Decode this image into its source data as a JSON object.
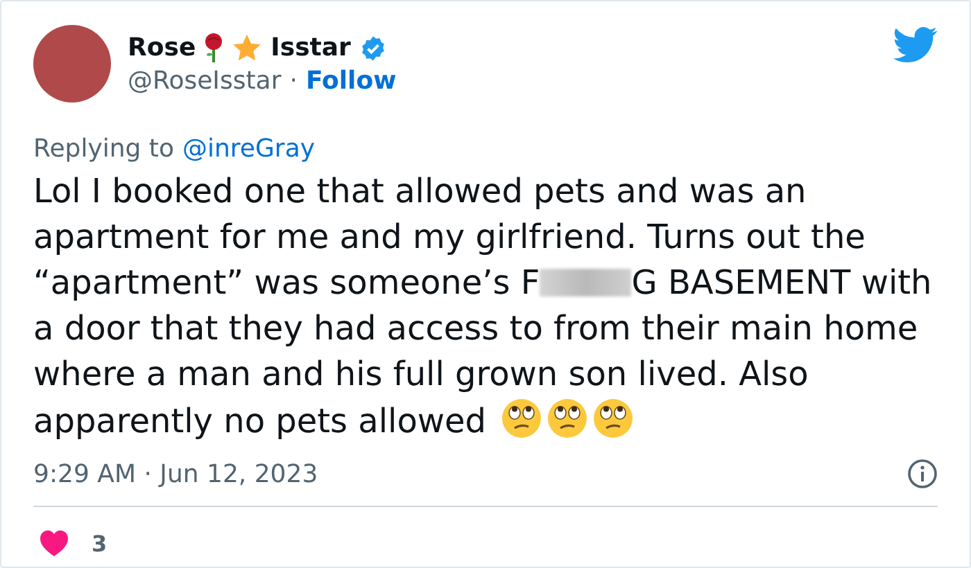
{
  "author": {
    "name_first": "Rose",
    "name_last": "Isstar",
    "handle": "@RoseIsstar",
    "separator": "·",
    "follow": "Follow",
    "verified": true
  },
  "reply": {
    "label": "Replying to",
    "mention": "@inreGray"
  },
  "body": {
    "before_censor": "Lol I booked one that allowed pets and was an apartment for me and my girlfriend. Turns out the “apartment” was someone’s F",
    "after_censor": "G BASEMENT with a door that they had access to from their main home where a man and his full grown son lived. Also apparently no pets allowed"
  },
  "timestamp": "9:29 AM · Jun 12, 2023",
  "likes": "3"
}
